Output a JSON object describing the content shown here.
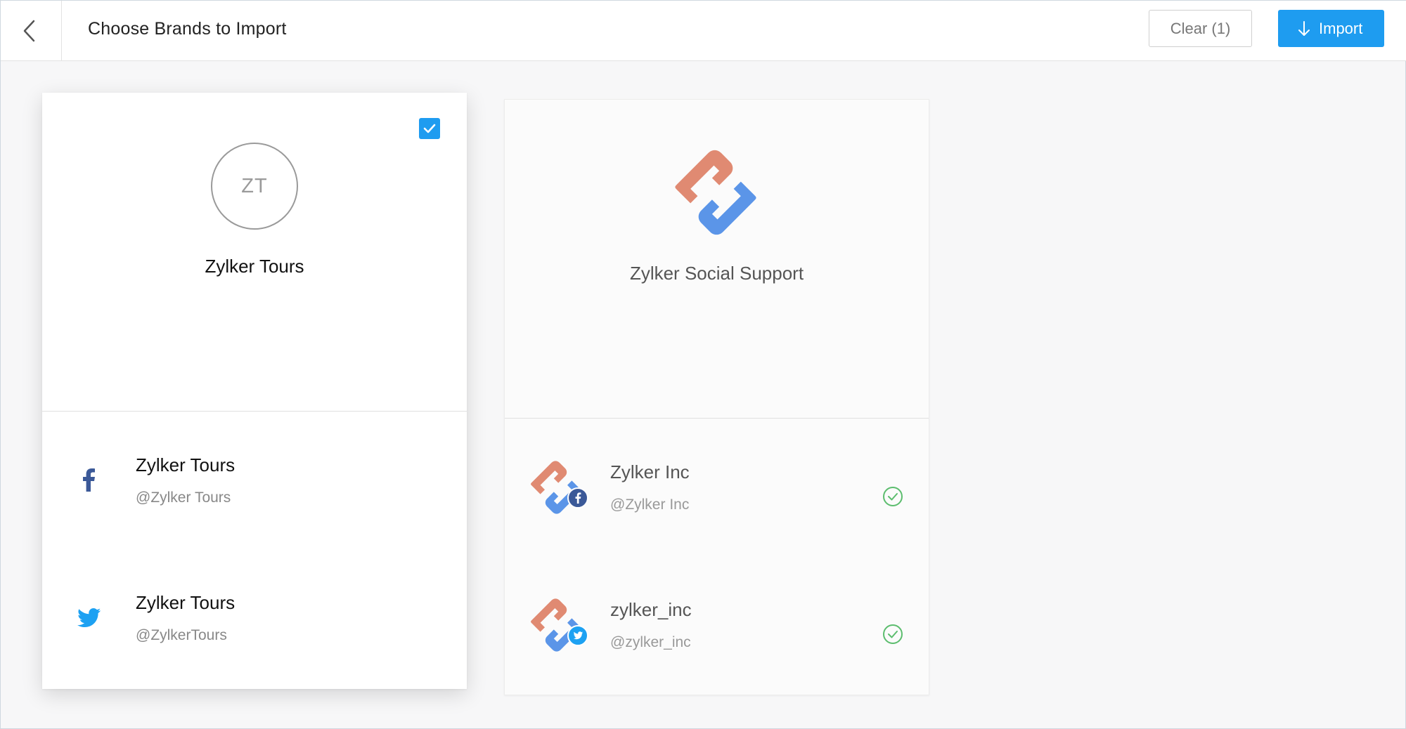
{
  "header": {
    "title": "Choose Brands to Import",
    "clear_label": "Clear (1)",
    "import_label": "Import"
  },
  "icons": {
    "back": "chevron-left-icon",
    "import": "arrow-down-icon",
    "checkbox": "check-icon",
    "facebook": "facebook-icon",
    "twitter": "twitter-icon",
    "imported": "check-circle-icon"
  },
  "colors": {
    "accent": "#1e9cf0",
    "facebook": "#3b5998",
    "twitter": "#1da1f2",
    "logo_red": "#e08a72",
    "logo_blue": "#5b95e8",
    "imported_green": "#5cbd6e"
  },
  "brands": [
    {
      "avatar_initials": "ZT",
      "name": "Zylker Tours",
      "selected": true,
      "accounts": [
        {
          "network": "facebook",
          "name": "Zylker Tours",
          "handle": "@Zylker Tours"
        },
        {
          "network": "twitter",
          "name": "Zylker Tours",
          "handle": "@ZylkerTours"
        }
      ]
    },
    {
      "name": "Zylker Social Support",
      "selected": false,
      "accounts": [
        {
          "network": "facebook",
          "name": "Zylker Inc",
          "handle": "@Zylker Inc",
          "imported": true
        },
        {
          "network": "twitter",
          "name": "zylker_inc",
          "handle": "@zylker_inc",
          "imported": true
        }
      ]
    }
  ]
}
